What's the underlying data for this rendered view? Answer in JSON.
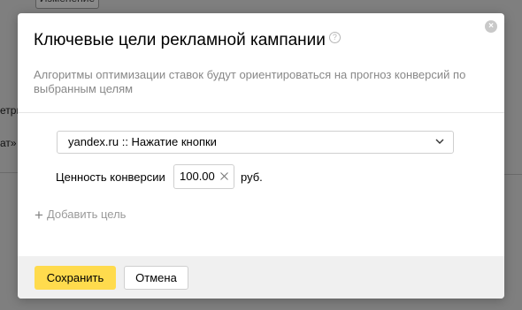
{
  "background": {
    "top_button_label": "Изменение",
    "text_1": "етри",
    "text_2": "ат»"
  },
  "modal": {
    "title": "Ключевые цели рекламной кампании",
    "help_symbol": "?",
    "close_symbol": "×",
    "description": "Алгоритмы оптимизации ставок будут ориентироваться на прогноз конверсий по выбранным целям",
    "goal_select": {
      "value": "yandex.ru :: Нажатие кнопки"
    },
    "conversion": {
      "label": "Ценность конверсии",
      "value": "100.00",
      "unit": "руб."
    },
    "add_goal": {
      "icon": "+",
      "label": "Добавить цель"
    },
    "footer": {
      "save_label": "Сохранить",
      "cancel_label": "Отмена"
    }
  },
  "colors": {
    "overlay": "#7f7f7f",
    "accent": "#ffdb4d",
    "muted_text": "#888888",
    "footer_bg": "#f0f0f0"
  }
}
